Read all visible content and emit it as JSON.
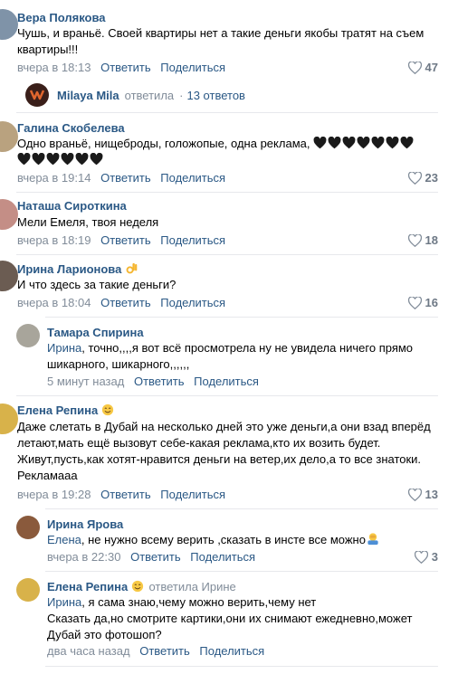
{
  "actions": {
    "reply": "Ответить",
    "share": "Поделиться"
  },
  "comments": [
    {
      "author": "Вера Полякова",
      "text1": "Чушь, и враньё. Своей квартиры нет а такие деньги якобы тратят на съем",
      "text2": "квартиры!!!",
      "time": "вчера в 18:13",
      "likes": "47"
    },
    {
      "author": "Галина Скобелева",
      "text1": "Одно враньё, нищеброды, голожопые, одна реклама,",
      "time": "вчера в 19:14",
      "likes": "23"
    },
    {
      "author": "Наташа Сироткина",
      "text1": "Мели Емеля, твоя неделя",
      "time": "вчера в 18:19",
      "likes": "18"
    },
    {
      "author": "Ирина Ларионова",
      "text1": "И что здесь за такие деньги?",
      "time": "вчера в 18:04",
      "likes": "16"
    },
    {
      "author": "Елена Репина",
      "text1": "Даже слетать в Дубай на несколько дней это уже деньги,а они взад вперёд",
      "text2": "летают,мать ещё вызовут себе-какая реклама,кто их возить будет.",
      "text3": "Живут,пусть,как хотят-нравится деньги на ветер,их дело,а то все знатоки.",
      "text4": "Рекламааа",
      "time": "вчера в 19:28",
      "likes": "13"
    }
  ],
  "summary": {
    "author": "Milaya Mila",
    "action": "ответила",
    "separator": "·",
    "count": "13 ответов"
  },
  "replies": [
    {
      "author": "Тамара Спирина",
      "addressee": "Ирина",
      "text1": ", точно,,,,я вот всё просмотрела ну не увидела ничего прямо",
      "text2": "шикарного, шикарного,,,,,,",
      "time": "5 минут назад"
    },
    {
      "author": "Ирина Ярова",
      "addressee": "Елена",
      "text1": ", не нужно всему верить ,сказать в инсте все можно",
      "time": "вчера в 22:30",
      "likes": "3"
    },
    {
      "author": "Елена Репина",
      "action": "ответила Ирине",
      "addressee": "Ирина",
      "text1": ", я сама знаю,чему можно верить,чему нет",
      "text2": "Сказать да,но смотрите картики,они их снимают ежедневно,может",
      "text3": "Дубай это фотошоп?",
      "time": "два часа назад"
    }
  ],
  "colors": {
    "link": "#2a5885",
    "meta": "#818c99",
    "divider": "#e7e8ec"
  }
}
